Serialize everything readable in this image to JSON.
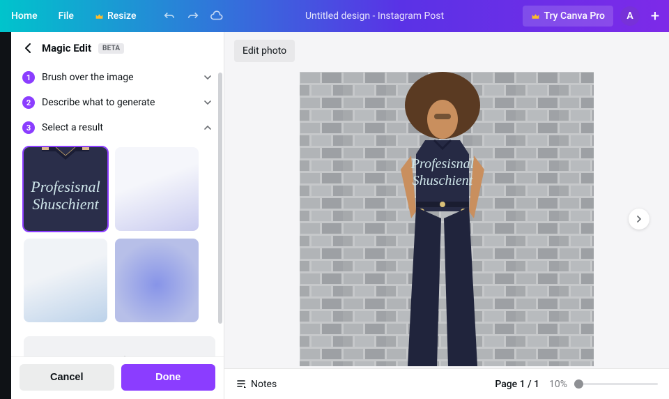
{
  "topbar": {
    "home": "Home",
    "file": "File",
    "resize": "Resize",
    "title": "Untitled design - Instagram Post",
    "try_pro": "Try Canva Pro",
    "avatar_initial": "A"
  },
  "panel": {
    "title": "Magic Edit",
    "beta": "BETA",
    "steps": [
      {
        "num": "1",
        "label": "Brush over the image"
      },
      {
        "num": "2",
        "label": "Describe what to generate"
      },
      {
        "num": "3",
        "label": "Select a result"
      }
    ],
    "tile_text_line1": "Profesisnal",
    "tile_text_line2": "Shuschient",
    "cancel": "Cancel",
    "done": "Done"
  },
  "canvas": {
    "edit_photo": "Edit photo",
    "notes": "Notes",
    "page_indicator": "Page 1 / 1",
    "zoom": "10%",
    "shirt_line1": "Profesisnal",
    "shirt_line2": "Shuschient"
  }
}
